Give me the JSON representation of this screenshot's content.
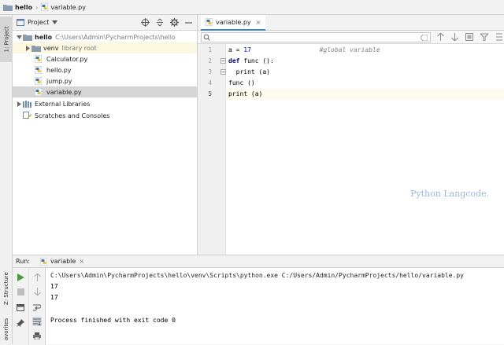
{
  "breadcrumb": {
    "project": "hello",
    "file": "variable.py"
  },
  "left_stripe": {
    "project_tab": "1: Project",
    "structure_tab": "Z: Structure",
    "favorites_tab": "avorites"
  },
  "project_panel": {
    "title": "Project",
    "tree": [
      {
        "label": "hello",
        "secondary": "C:\\Users\\Admin\\PycharmProjects\\hello"
      },
      {
        "label": "venv",
        "secondary": "library root"
      },
      {
        "label": "Calculator.py"
      },
      {
        "label": "hello.py"
      },
      {
        "label": "jump.py"
      },
      {
        "label": "variable.py"
      },
      {
        "label": "External Libraries"
      },
      {
        "label": "Scratches and Consoles"
      }
    ]
  },
  "editor": {
    "tab": "variable.py",
    "search_placeholder": "",
    "line_numbers": [
      "1",
      "2",
      "3",
      "4",
      "5"
    ],
    "lines": [
      {
        "parts": [
          [
            "a = ",
            ""
          ],
          [
            "17",
            "num"
          ],
          [
            "                  ",
            ""
          ],
          [
            "#global variable",
            "cm"
          ]
        ]
      },
      {
        "parts": [
          [
            "def",
            "kw"
          ],
          [
            " func ():",
            ""
          ]
        ]
      },
      {
        "parts": [
          [
            "  print (a)",
            ""
          ]
        ]
      },
      {
        "parts": [
          [
            "func ()",
            ""
          ]
        ]
      },
      {
        "parts": [
          [
            "print (a)",
            ""
          ]
        ]
      }
    ],
    "watermark": "Python Langcode."
  },
  "run": {
    "label": "Run:",
    "tab": "variable",
    "console": [
      "C:\\Users\\Admin\\PycharmProjects\\hello\\venv\\Scripts\\python.exe C:/Users/Admin/PycharmProjects/hello/variable.py",
      "17",
      "17",
      "",
      "Process finished with exit code 0"
    ]
  },
  "colors": {
    "accent": "#4083c9",
    "selection": "#d5d5d5",
    "run_green": "#4a9c3f",
    "folder": "#8a9bb0"
  },
  "icons": [
    "folder-icon",
    "python-file-icon",
    "gear-icon",
    "crosshair-icon",
    "collapse-icon",
    "minimize-icon",
    "search-icon",
    "arrow-up-icon",
    "arrow-down-icon",
    "run-icon",
    "stop-icon",
    "wrap-icon",
    "pin-icon",
    "print-icon"
  ]
}
